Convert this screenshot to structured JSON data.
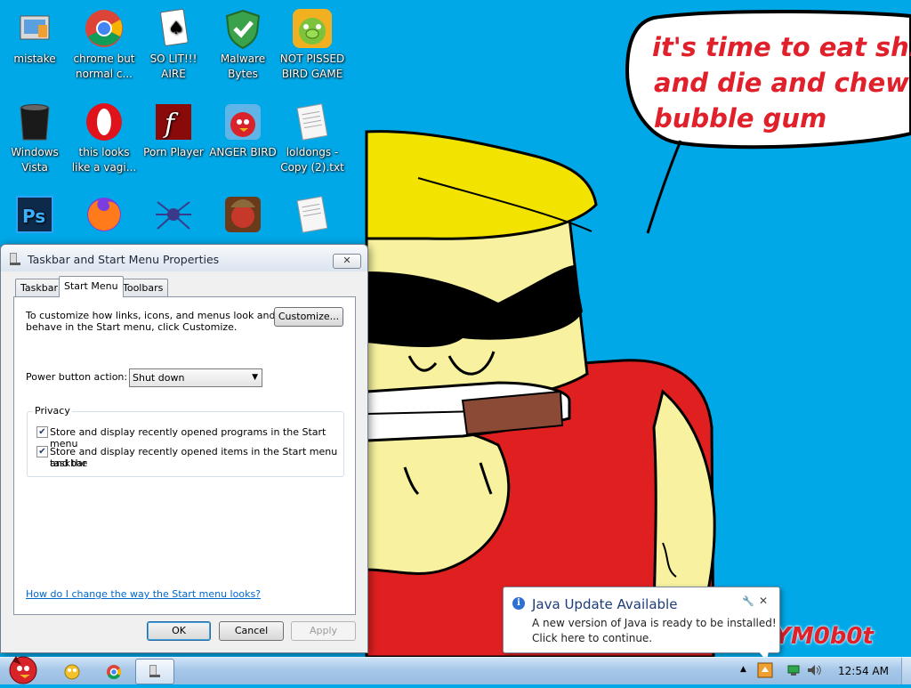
{
  "wallpaper": {
    "speech_lines": [
      "it's time to eat shit",
      "and die and chew",
      "bubble gum"
    ],
    "signature": "YM0b0t"
  },
  "desktop_icons": [
    {
      "label": "mistake",
      "icon": "photo-frame-icon"
    },
    {
      "label": "chrome but normal c...",
      "icon": "chrome-icon"
    },
    {
      "label": "SO LIT!!! AIRE",
      "icon": "solitaire-icon"
    },
    {
      "label": "Malware Bytes",
      "icon": "shield-icon"
    },
    {
      "label": "NOT PISSED BIRD GAME",
      "icon": "green-pig-icon"
    },
    {
      "label": "Windows Vista",
      "icon": "trash-bin-icon"
    },
    {
      "label": "this looks like a vagi...",
      "icon": "opera-icon"
    },
    {
      "label": "Porn Player",
      "icon": "flash-icon"
    },
    {
      "label": "ANGER BIRD",
      "icon": "red-bird-icon"
    },
    {
      "label": "loldongs - Copy (2).txt",
      "icon": "text-document-icon"
    },
    {
      "label": "",
      "icon": "photoshop-icon"
    },
    {
      "label": "",
      "icon": "firefox-icon"
    },
    {
      "label": "",
      "icon": "spider-solitaire-icon"
    },
    {
      "label": "",
      "icon": "seasons-bird-icon"
    },
    {
      "label": "",
      "icon": "text-document-icon"
    }
  ],
  "dialog": {
    "title": "Taskbar and Start Menu Properties",
    "tabs": [
      "Taskbar",
      "Start Menu",
      "Toolbars"
    ],
    "active_tab": "Start Menu",
    "customize_line1": "To customize how links, icons, and menus look and",
    "customize_line2": "behave in the Start menu, click Customize.",
    "customize_button": "Customize...",
    "power_label": "Power button action:",
    "power_value": "Shut down",
    "privacy_legend": "Privacy",
    "checkbox1_label": "Store and display recently opened programs in the Start menu",
    "checkbox1_checked": true,
    "checkbox2_line1": "Store and display recently opened items in the Start menu and the",
    "checkbox2_line2": "taskbar",
    "checkbox2_checked": true,
    "help_link": "How do I change the way the Start menu looks?",
    "ok": "OK",
    "cancel": "Cancel",
    "apply": "Apply"
  },
  "notification": {
    "title": "Java Update Available",
    "line1": "A new version of Java is ready to be installed!",
    "line2": "Click here to continue."
  },
  "taskbar": {
    "clock": "12:54 AM",
    "pinned": [
      "red-bird-start-icon",
      "folder-icon",
      "chrome-icon",
      "properties-window-icon"
    ],
    "tray": [
      "java-update-icon",
      "network-icon",
      "volume-icon"
    ]
  }
}
